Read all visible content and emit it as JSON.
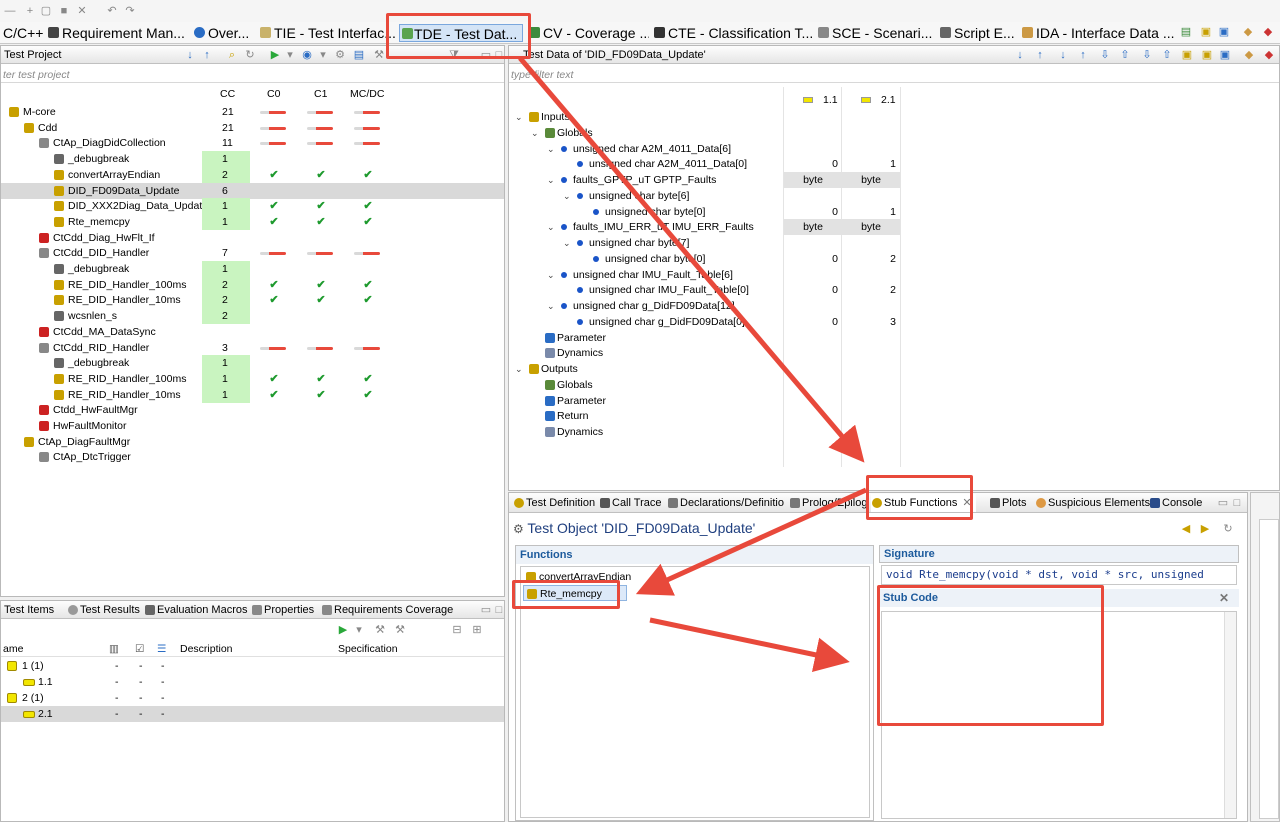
{
  "perspectives": [
    {
      "label": "C/C++"
    },
    {
      "label": "Requirement Man..."
    },
    {
      "label": "Over..."
    },
    {
      "label": "TIE - Test Interfac..."
    },
    {
      "label": "TDE - Test Dat..."
    },
    {
      "label": "CV - Coverage ..."
    },
    {
      "label": "CTE - Classification T..."
    },
    {
      "label": "SCE - Scenari..."
    },
    {
      "label": "Script E..."
    },
    {
      "label": "IDA - Interface Data ..."
    }
  ],
  "project": {
    "title": "Test Project",
    "filter": "ter test project",
    "cols": [
      "CC",
      "C0",
      "C1",
      "MC/DC"
    ],
    "rows": [
      {
        "label": "M-core",
        "cc": "21"
      },
      {
        "label": "Cdd",
        "cc": "21"
      },
      {
        "label": "CtAp_DiagDidCollection",
        "cc": "11"
      },
      {
        "label": "_debugbreak",
        "cc": "1"
      },
      {
        "label": "convertArrayEndian",
        "cc": "2"
      },
      {
        "label": "DID_FD09Data_Update",
        "cc": "6"
      },
      {
        "label": "DID_XXX2Diag_Data_Update",
        "cc": "1"
      },
      {
        "label": "Rte_memcpy",
        "cc": "1"
      },
      {
        "label": "CtCdd_Diag_HwFlt_If",
        "cc": ""
      },
      {
        "label": "CtCdd_DID_Handler",
        "cc": "7"
      },
      {
        "label": "_debugbreak",
        "cc": "1"
      },
      {
        "label": "RE_DID_Handler_100ms",
        "cc": "2"
      },
      {
        "label": "RE_DID_Handler_10ms",
        "cc": "2"
      },
      {
        "label": "wcsnlen_s",
        "cc": "2"
      },
      {
        "label": "CtCdd_MA_DataSync",
        "cc": ""
      },
      {
        "label": "CtCdd_RID_Handler",
        "cc": "3"
      },
      {
        "label": "_debugbreak",
        "cc": "1"
      },
      {
        "label": "RE_RID_Handler_100ms",
        "cc": "1"
      },
      {
        "label": "RE_RID_Handler_10ms",
        "cc": "1"
      },
      {
        "label": "Ctdd_HwFaultMgr",
        "cc": ""
      },
      {
        "label": "HwFaultMonitor",
        "cc": ""
      },
      {
        "label": "CtAp_DiagFaultMgr",
        "cc": ""
      },
      {
        "label": "CtAp_DtcTrigger",
        "cc": ""
      }
    ]
  },
  "testdata": {
    "title": "Test Data of 'DID_FD09Data_Update'",
    "filter": "type filter text",
    "cols": [
      "1.1",
      "2.1"
    ],
    "rows": [
      {
        "label": "Inputs",
        "v1": "",
        "v2": ""
      },
      {
        "label": "Globals",
        "v1": "",
        "v2": ""
      },
      {
        "label": "unsigned char A2M_4011_Data[6]",
        "v1": "",
        "v2": ""
      },
      {
        "label": "unsigned char  A2M_4011_Data[0]",
        "v1": "0",
        "v2": "1"
      },
      {
        "label": "faults_GPTP_uT GPTP_Faults",
        "v1": "byte",
        "v2": "byte"
      },
      {
        "label": "unsigned char byte[6]",
        "v1": "",
        "v2": ""
      },
      {
        "label": "unsigned char  byte[0]",
        "v1": "0",
        "v2": "1"
      },
      {
        "label": "faults_IMU_ERR_uT IMU_ERR_Faults",
        "v1": "byte",
        "v2": "byte"
      },
      {
        "label": "unsigned char byte[7]",
        "v1": "",
        "v2": ""
      },
      {
        "label": "unsigned char  byte[0]",
        "v1": "0",
        "v2": "2"
      },
      {
        "label": "unsigned char IMU_Fault_Table[6]",
        "v1": "",
        "v2": ""
      },
      {
        "label": "unsigned char  IMU_Fault_Table[0]",
        "v1": "0",
        "v2": "2"
      },
      {
        "label": "unsigned char g_DidFD09Data[12]",
        "v1": "",
        "v2": ""
      },
      {
        "label": "unsigned char  g_DidFD09Data[0]",
        "v1": "0",
        "v2": "3"
      },
      {
        "label": "Parameter",
        "v1": "",
        "v2": ""
      },
      {
        "label": "Dynamics",
        "v1": "",
        "v2": ""
      },
      {
        "label": "Outputs",
        "v1": "",
        "v2": ""
      },
      {
        "label": "Globals",
        "v1": "",
        "v2": ""
      },
      {
        "label": "Parameter",
        "v1": "",
        "v2": ""
      },
      {
        "label": "Return",
        "v1": "",
        "v2": ""
      },
      {
        "label": "Dynamics",
        "v1": "",
        "v2": ""
      }
    ]
  },
  "bottom_tabs": [
    "Test Definition",
    "Call Trace",
    "Declarations/Definitio",
    "Prolog/Epilog",
    "Stub Functions",
    "Plots",
    "Suspicious Elements",
    "Console"
  ],
  "stub": {
    "title": "Test Object 'DID_FD09Data_Update'",
    "functions_label": "Functions",
    "functions": [
      "convertArrayEndian",
      "Rte_memcpy"
    ],
    "signature_label": "Signature",
    "signature": "void Rte_memcpy(void * dst, void * src, unsigned",
    "stubcode_label": "Stub Code"
  },
  "items": {
    "tabs": [
      "Test Items",
      "Test Results",
      "Evaluation Macros",
      "Properties",
      "Requirements Coverage"
    ],
    "cols": [
      "ame",
      "Description",
      "Specification"
    ],
    "rows": [
      {
        "label": "1 (1)",
        "a": "-",
        "b": "-",
        "c": "-"
      },
      {
        "label": "1.1",
        "a": "-",
        "b": "-",
        "c": "-"
      },
      {
        "label": "2 (1)",
        "a": "-",
        "b": "-",
        "c": "-"
      },
      {
        "label": "2.1",
        "a": "-",
        "b": "-",
        "c": "-"
      }
    ]
  }
}
